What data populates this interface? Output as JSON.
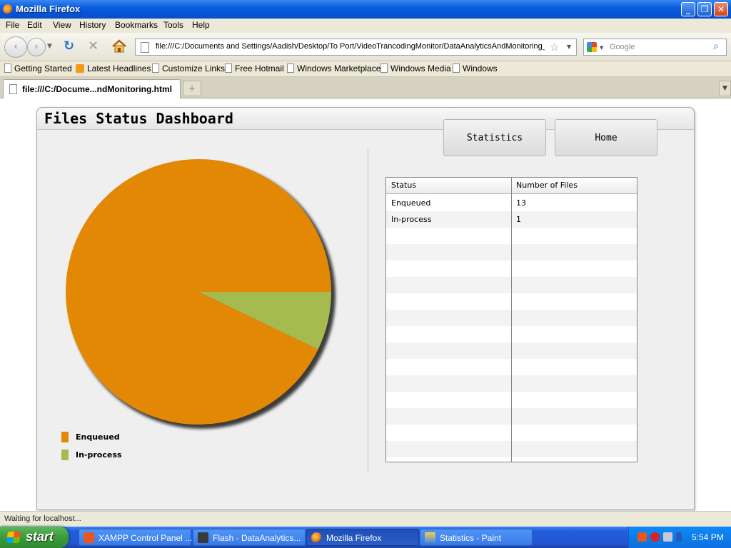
{
  "window": {
    "title": "Mozilla Firefox"
  },
  "menu": [
    "File",
    "Edit",
    "View",
    "History",
    "Bookmarks",
    "Tools",
    "Help"
  ],
  "nav": {
    "url": "file:///C:/Documents and Settings/Aadish/Desktop/To Port/VideoTrancodingMonitor/DataAnalyticsAndMonitoring_M",
    "search_placeholder": "Google"
  },
  "bookmarks": [
    "Getting Started",
    "Latest Headlines",
    "Customize Links",
    "Free Hotmail",
    "Windows Marketplace",
    "Windows Media",
    "Windows"
  ],
  "tabs": [
    {
      "label": "file:///C:/Docume...ndMonitoring.html"
    }
  ],
  "dashboard": {
    "title": "Files Status Dashboard",
    "buttons": {
      "statistics": "Statistics",
      "home": "Home"
    },
    "legend": [
      {
        "label": "Enqueued",
        "color": "#e38805"
      },
      {
        "label": "In-process",
        "color": "#a6bb4f"
      }
    ],
    "table": {
      "columns": [
        "Status",
        "Number of Files"
      ],
      "rows": [
        [
          "Enqueued",
          "13"
        ],
        [
          "In-process",
          "1"
        ]
      ]
    }
  },
  "chart_data": {
    "type": "pie",
    "categories": [
      "Enqueued",
      "In-process"
    ],
    "values": [
      13,
      1
    ],
    "colors": [
      "#e38805",
      "#a6bb4f"
    ]
  },
  "status": {
    "text": "Waiting for localhost..."
  },
  "taskbar": {
    "start": "start",
    "tasks": [
      "XAMPP Control Panel ...",
      "Flash - DataAnalytics...",
      "Mozilla Firefox",
      "Statistics - Paint"
    ],
    "clock": "5:54 PM"
  }
}
